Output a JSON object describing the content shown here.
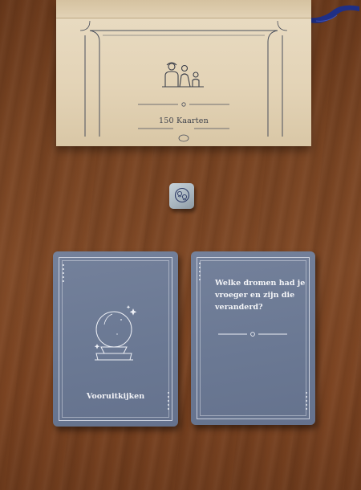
{
  "box": {
    "title": "150 Kaarten"
  },
  "cards": {
    "left": {
      "label": "Vooruitkijken",
      "icon": "crystal-ball-icon"
    },
    "right": {
      "question": "Welke dromen had je vroeger en zijn die veranderd?"
    }
  },
  "die": {
    "icon": "faces-icon"
  },
  "colors": {
    "table": "#7a4523",
    "card": "#6e7b96",
    "box": "#e3d3b6",
    "ink": "#3b3f4a"
  }
}
